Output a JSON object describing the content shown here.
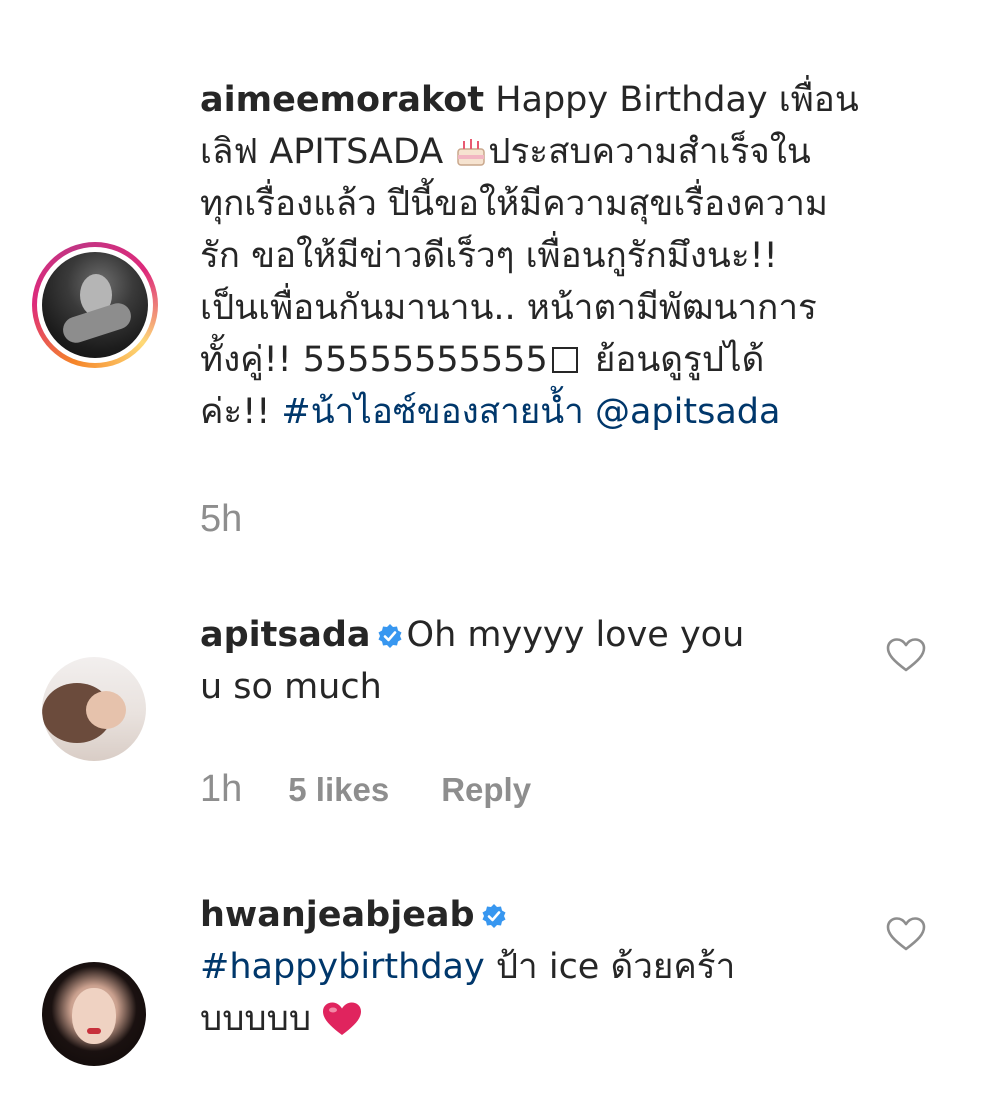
{
  "comments": [
    {
      "username": "aimeemorakot",
      "lines": [
        " Happy Birthday เพื่อน",
        "เลิฟ APITSADA ",
        "ประสบความสำเร็จใน",
        "ทุกเรื่องแล้ว ปีนี้ขอให้มีความสุขเรื่องความ",
        "รัก ขอให้มีข่าวดีเร็วๆ เพื่อนกูรักมึงนะ!!",
        "เป็นเพื่อนกันมานาน.. หน้าตามีพัฒนาการ",
        "ทั้งคู่!! 55555555555",
        " ย้อนดูรูปได้",
        "ค่ะ!! "
      ],
      "hashtag": "#น้าไอซ์ของสายน้ำ",
      "mention": "@apitsada",
      "emoji_icon": "birthday-cake-emoji",
      "time": "5h",
      "verified": false,
      "story_ring": true
    },
    {
      "username": "apitsada",
      "verified": true,
      "text_line1": "Oh myyyy love you",
      "text_line2": "u so much",
      "time": "1h",
      "likes": "5 likes",
      "reply": "Reply"
    },
    {
      "username": "hwanjeabjeab",
      "verified": true,
      "hashtag": "#happybirthday",
      "text_after_hashtag": " ป้า ice ด้วยคร้า",
      "text_line2": "บบบบบ ",
      "emoji_icon": "red-heart-emoji"
    }
  ],
  "colors": {
    "text": "#262626",
    "muted": "#8e8e8e",
    "link": "#00376b",
    "verified": "#3897f0",
    "heart_emoji": "#e0245e"
  },
  "icons": {
    "like": "heart-outline-icon",
    "verified": "verified-badge-icon"
  }
}
